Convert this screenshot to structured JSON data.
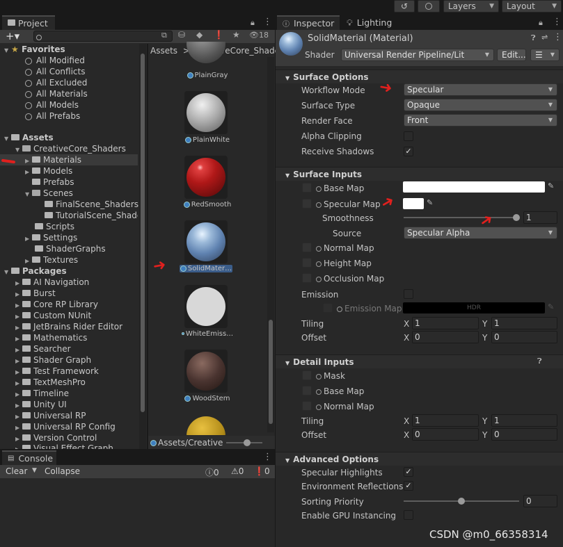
{
  "toolbar": {
    "layers_label": "Layers",
    "layout_label": "Layout"
  },
  "project": {
    "tab_label": "Project",
    "search_placeholder": "",
    "badge_count": "18",
    "favorites_label": "Favorites",
    "favorites": [
      "All Modified",
      "All Conflicts",
      "All Excluded",
      "All Materials",
      "All Models",
      "All Prefabs"
    ],
    "assets_label": "Assets",
    "creativecore": "CreativeCore_Shaders",
    "materials": "Materials",
    "models": "Models",
    "prefabs": "Prefabs",
    "scenes": "Scenes",
    "final_scene": "FinalScene_Shaders",
    "tutorial_scene": "TutorialScene_Shade",
    "scripts": "Scripts",
    "settings": "Settings",
    "shadergraphs": "ShaderGraphs",
    "textures": "Textures",
    "packages_label": "Packages",
    "packages": [
      "AI Navigation",
      "Burst",
      "Core RP Library",
      "Custom NUnit",
      "JetBrains Rider Editor",
      "Mathematics",
      "Searcher",
      "Shader Graph",
      "Test Framework",
      "TextMeshPro",
      "Timeline",
      "Unity UI",
      "Universal RP",
      "Universal RP Config",
      "Version Control",
      "Visual Effect Graph"
    ],
    "breadcrumb_root": "Assets",
    "breadcrumb_child": "CreativeCore_Shaders",
    "assets": [
      "PlainGray",
      "PlainWhite",
      "RedSmooth",
      "SolidMater…",
      "WhiteEmiss…",
      "WoodStem"
    ],
    "footer_path": "Assets/Creative"
  },
  "console": {
    "tab_label": "Console",
    "clear_label": "Clear",
    "collapse_label": "Collapse",
    "count_info": "0",
    "count_warn": "0",
    "count_error": "0"
  },
  "inspector": {
    "tab_label": "Inspector",
    "lighting_tab_label": "Lighting",
    "material_title": "SolidMaterial (Material)",
    "shader_label": "Shader",
    "shader_value": "Universal Render Pipeline/Lit",
    "edit_label": "Edit...",
    "surface_options": {
      "header": "Surface Options",
      "workflow_mode_label": "Workflow Mode",
      "workflow_mode_value": "Specular",
      "surface_type_label": "Surface Type",
      "surface_type_value": "Opaque",
      "render_face_label": "Render Face",
      "render_face_value": "Front",
      "alpha_clipping_label": "Alpha Clipping",
      "receive_shadows_label": "Receive Shadows"
    },
    "surface_inputs": {
      "header": "Surface Inputs",
      "base_map": "Base Map",
      "specular_map": "Specular Map",
      "smoothness_label": "Smoothness",
      "smoothness_value": "1",
      "source_label": "Source",
      "source_value": "Specular Alpha",
      "normal_map": "Normal Map",
      "height_map": "Height Map",
      "occlusion_map": "Occlusion Map",
      "emission_label": "Emission",
      "emission_map": "Emission Map",
      "hdr_label": "HDR",
      "tiling_label": "Tiling",
      "tiling_x": "1",
      "tiling_y": "1",
      "offset_label": "Offset",
      "offset_x": "0",
      "offset_y": "0",
      "x_label": "X",
      "y_label": "Y"
    },
    "detail_inputs": {
      "header": "Detail Inputs",
      "mask": "Mask",
      "base_map": "Base Map",
      "normal_map": "Normal Map",
      "tiling_label": "Tiling",
      "tiling_x": "1",
      "tiling_y": "1",
      "offset_label": "Offset",
      "offset_x": "0",
      "offset_y": "0"
    },
    "advanced_options": {
      "header": "Advanced Options",
      "specular_highlights": "Specular Highlights",
      "environment_reflections": "Environment Reflections",
      "sorting_priority_label": "Sorting Priority",
      "sorting_priority_value": "0",
      "gpu_instancing": "Enable GPU Instancing"
    }
  },
  "watermark": "CSDN @m0_66358314"
}
